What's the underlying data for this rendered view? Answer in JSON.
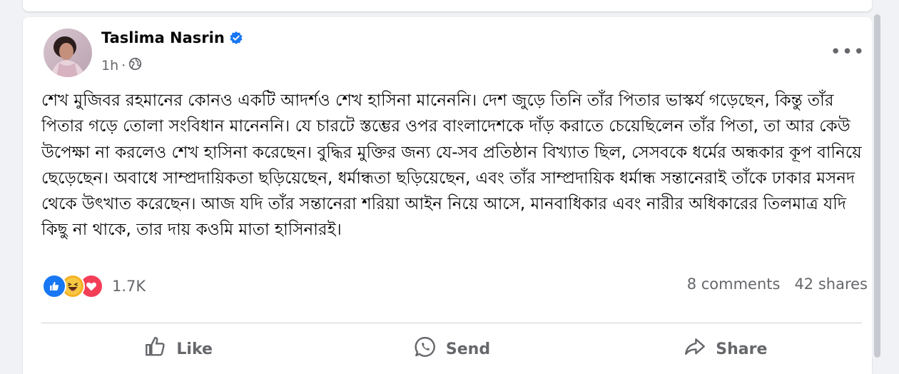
{
  "post": {
    "author": "Taslima Nasrin",
    "time": "1h",
    "paragraph": "শেখ মুজিবর রহমানের কোনও একটি আদর্শও শেখ হাসিনা মানেননি।  দেশ জুড়ে তিনি তাঁর  পিতার ভাস্কর্য গড়েছেন, কিন্তু তাঁর পিতার গড়ে তোলা সংবিধান মানেননি। যে চারটে স্তম্ভের ওপর বাংলাদেশকে দাঁড় করাতে চেয়েছিলেন তাঁর পিতা, তা আর কেউ উপেক্ষা না করলেও শেখ হাসিনা করেছেন। বুদ্ধির মুক্তির জন্য যে-সব প্রতিষ্ঠান বিখ্যাত ছিল, সেসবকে ধর্মের অন্ধকার কূপ বানিয়ে ছেড়েছেন। অবাধে সাম্প্রদায়িকতা ছড়িয়েছেন, ধর্মান্ধতা ছড়িয়েছেন, এবং তাঁর সাম্প্রদায়িক ধর্মান্ধ সন্তানেরাই তাঁকে ঢাকার মসনদ থেকে উৎখাত করেছেন। আজ যদি তাঁর সন্তানেরা শরিয়া আইন নিয়ে আসে, মানবাধিকার এবং নারীর অধিকারের তিলমাত্র যদি কিছু না থাকে, তার দায় কওমি মাতা হাসিনারই।",
    "reactions_count": "1.7K",
    "comments": "8 comments",
    "shares": "42 shares",
    "reaction_icons": [
      "like-icon",
      "haha-icon",
      "love-icon"
    ]
  },
  "actions": {
    "like": "Like",
    "send": "Send",
    "share": "Share"
  },
  "colors": {
    "brand_blue": "#1877f2",
    "text_primary": "#050505",
    "text_secondary": "#65676b",
    "background": "#f0f2f5"
  }
}
